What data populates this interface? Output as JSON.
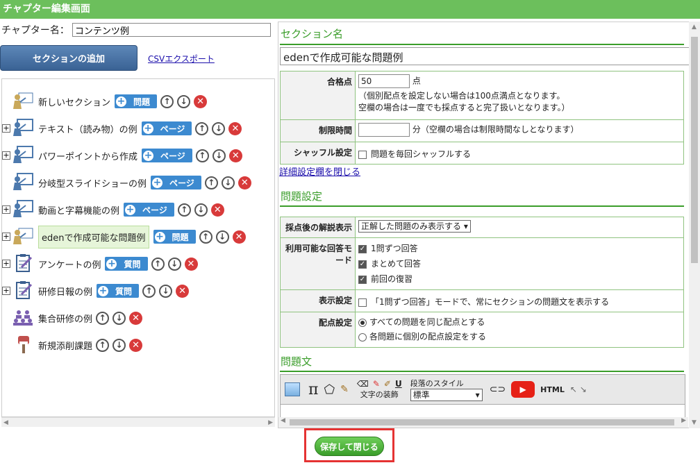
{
  "window": {
    "title": "チャプター編集画面"
  },
  "chapter": {
    "label": "チャプター名：",
    "value": "コンテンツ例"
  },
  "actions": {
    "add_section": "セクションの追加",
    "csv_export": "CSVエクスポート",
    "save_close": "保存して閉じる"
  },
  "tree": {
    "items": [
      {
        "label": "新しいセクション",
        "type": "問題",
        "expander": "",
        "icon": "teacher-icon"
      },
      {
        "label": "テキスト（読み物）の例",
        "type": "ページ",
        "expander": "+",
        "icon": "presentation-icon"
      },
      {
        "label": "パワーポイントから作成",
        "type": "ページ",
        "expander": "+",
        "icon": "presentation-icon"
      },
      {
        "label": "分岐型スライドショーの例",
        "type": "ページ",
        "expander": "",
        "icon": "presentation-icon"
      },
      {
        "label": "動画と字幕機能の例",
        "type": "ページ",
        "expander": "+",
        "icon": "presentation-icon"
      },
      {
        "label": "edenで作成可能な問題例",
        "type": "問題",
        "expander": "+",
        "icon": "teacher-icon"
      },
      {
        "label": "アンケートの例",
        "type": "質問",
        "expander": "+",
        "icon": "clipboard-icon"
      },
      {
        "label": "研修日報の例",
        "type": "質問",
        "expander": "+",
        "icon": "clipboard-icon"
      },
      {
        "label": "集合研修の例",
        "type": "",
        "expander": "",
        "icon": "group-icon"
      },
      {
        "label": "新規添削課題",
        "type": "",
        "expander": "",
        "icon": "post-icon"
      }
    ]
  },
  "section": {
    "header": "セクション名",
    "name": "edenで作成可能な問題例",
    "pass_label": "合格点",
    "pass_value": "50",
    "pass_unit": "点",
    "pass_note1": "（個別配点を設定しない場合は100点満点となります。",
    "pass_note2": "空欄の場合は一度でも採点すると完了扱いとなります。）",
    "time_label": "制限時間",
    "time_value": "",
    "time_note": "分（空欄の場合は制限時間なしとなります）",
    "shuffle_label": "シャッフル設定",
    "shuffle_text": "問題を毎回シャッフルする",
    "close_detail": "詳細設定欄を閉じる"
  },
  "question_settings": {
    "header": "問題設定",
    "explain_label": "採点後の解説表示",
    "explain_value": "正解した問題のみ表示する",
    "mode_label": "利用可能な回答モード",
    "mode1": "1問ずつ回答",
    "mode2": "まとめて回答",
    "mode3": "前回の復習",
    "display_label": "表示設定",
    "display_text": "「1問ずつ回答」モードで、常にセクションの問題文を表示する",
    "score_label": "配点設定",
    "score1": "すべての問題を同じ配点とする",
    "score2": "各問題に個別の配点設定をする"
  },
  "question_text": {
    "header": "問題文",
    "style_label": "段落のスタイル",
    "style_value": "標準",
    "decor_label": "文字の装飾",
    "pi": "π",
    "html": "HTML",
    "u": "U"
  }
}
